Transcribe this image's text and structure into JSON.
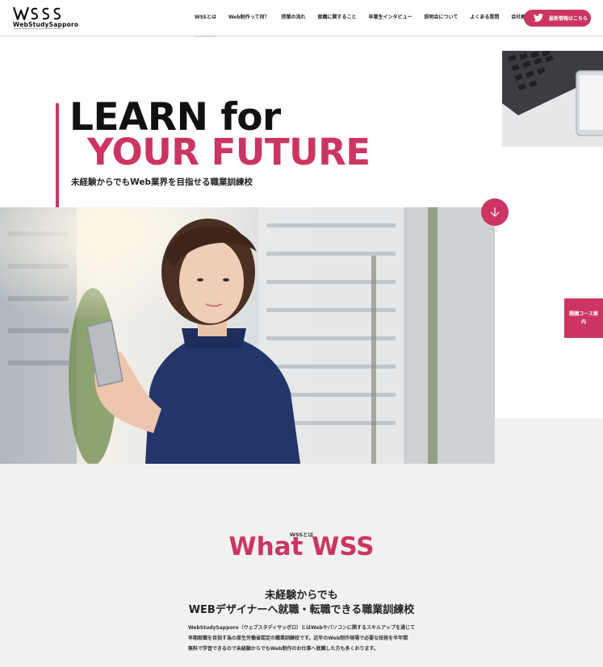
{
  "header": {
    "logo_text": "WebStudySapporo",
    "nav": [
      "WSSとは",
      "Web制作って何？",
      "授業の流れ",
      "就職に関すること",
      "卒業生インタビュー",
      "説明会について",
      "よくある質問",
      "会社概要"
    ],
    "twitter_button": "最新情報はこちら"
  },
  "hero": {
    "line1": "LEARN for",
    "line2": "YOUR FUTURE",
    "subtitle": "未経験からでもWeb業界を目指せる職業訓練校",
    "scroll_label": "scroll"
  },
  "side_tab": {
    "label": "開講コース案内"
  },
  "about": {
    "kicker": "WSSとは",
    "title": "What WSS",
    "headline1": "未経験からでも",
    "headline2": "WEBデザイナーへ就職・転職できる職業訓練校",
    "body": [
      "WebStudySapporo（ウェブスタディサッポロ）とはWebやパソコンに関するスキルアップを通じて",
      "早期就職を目指す為の厚生労働省認定の職業訓練校です。近年のWeb制作現場で必要な技術を半年間",
      "無料で学習できるので未経験からでもWeb制作のお仕事へ就職した方も多くおります。"
    ]
  },
  "colors": {
    "accent": "#cc3562",
    "background_band": "#f1f1f1"
  },
  "icons": {
    "twitter": "twitter-bird-icon",
    "scroll": "arrow-down-icon"
  }
}
